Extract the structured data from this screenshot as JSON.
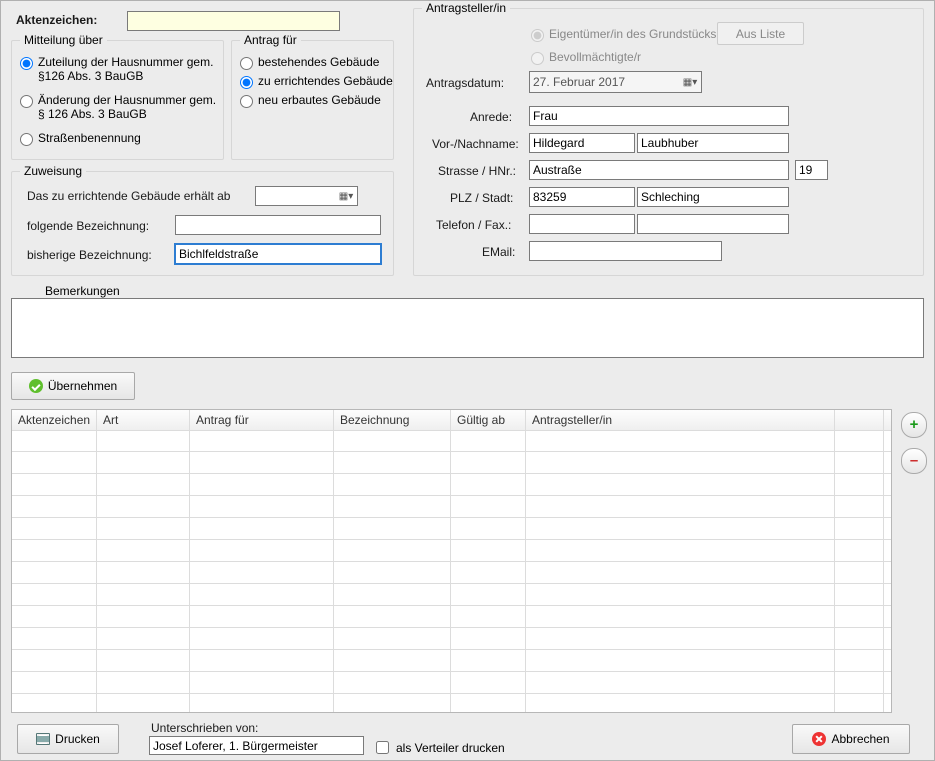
{
  "aktenzeichen": {
    "label": "Aktenzeichen:",
    "value": ""
  },
  "mitteilung": {
    "legend": "Mitteilung über",
    "options": [
      "Zuteilung der Hausnummer gem. §126 Abs. 3 BauGB",
      "Änderung der Hausnummer gem. § 126 Abs. 3 BauGB",
      "Straßenbenennung"
    ],
    "selected": 0
  },
  "antragfuer": {
    "legend": "Antrag für",
    "options": [
      "bestehendes Gebäude",
      "zu errichtendes Gebäude",
      "neu erbautes Gebäude"
    ],
    "selected": 1
  },
  "zuweisung": {
    "legend": "Zuweisung",
    "line1": "Das zu errichtende Gebäude  erhält ab",
    "date_value": "",
    "line2_label": "folgende Bezeichnung:",
    "line2_value": "",
    "line3_label": "bisherige Bezeichnung:",
    "line3_value": "Bichlfeldstraße"
  },
  "antragsteller": {
    "legend": "Antragsteller/in",
    "role_options": [
      "Eigentümer/in des Grundstücks",
      "Bevollmächtigte/r"
    ],
    "role_selected": 0,
    "aus_liste_label": "Aus Liste",
    "rows": {
      "datum_label": "Antragsdatum:",
      "datum_value": "27.  Februar  2017",
      "anrede_label": "Anrede:",
      "anrede_value": "Frau",
      "name_label": "Vor-/Nachname:",
      "vorname": "Hildegard",
      "nachname": "Laubhuber",
      "strasse_label": "Strasse / HNr.:",
      "strasse": "Austraße",
      "hnr": "19",
      "plz_label": "PLZ / Stadt:",
      "plz": "83259",
      "stadt": "Schleching",
      "telfax_label": "Telefon / Fax.:",
      "tel": "",
      "fax": "",
      "email_label": "EMail:",
      "email": ""
    }
  },
  "bemerkungen": {
    "legend": "Bemerkungen",
    "value": ""
  },
  "buttons": {
    "uebernehmen": "Übernehmen",
    "drucken": "Drucken",
    "abbrechen": "Abbrechen"
  },
  "grid": {
    "headers": [
      "Aktenzeichen",
      "Art",
      "Antrag für",
      "Bezeichnung",
      "Gültig ab",
      "Antragsteller/in",
      ""
    ]
  },
  "footer": {
    "unterzeichner_label": "Unterschrieben von:",
    "unterzeichner_value": "Josef Loferer, 1. Bürgermeister",
    "als_verteiler_label": "als Verteiler drucken"
  }
}
